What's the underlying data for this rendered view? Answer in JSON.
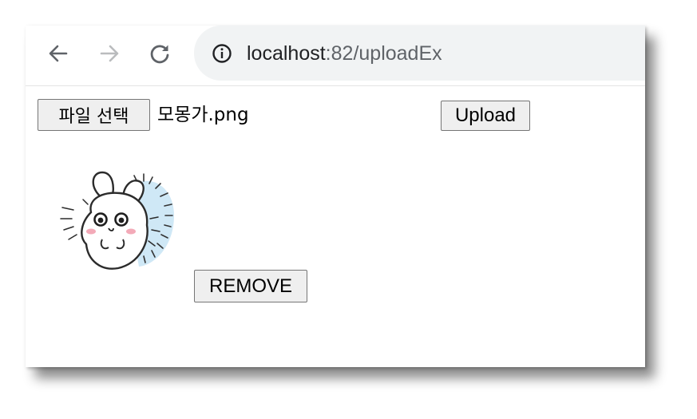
{
  "browser": {
    "back_icon": "arrow-left-icon",
    "forward_icon": "arrow-right-icon",
    "reload_icon": "reload-icon",
    "site_info_icon": "info-icon",
    "url_host": "localhost",
    "url_port": ":82",
    "url_path": "/uploadEx"
  },
  "upload_form": {
    "file_button_label": "파일 선택",
    "selected_file_name": "모몽가.png",
    "upload_button_label": "Upload"
  },
  "preview": {
    "thumbnail_subject": "rabbit-cartoon",
    "remove_button_label": "REMOVE"
  },
  "colors": {
    "toolbar_icon": "#5f6368",
    "toolbar_icon_disabled": "#babcbe",
    "omnibox_bg": "#f1f3f4",
    "button_bg": "#efefef",
    "button_border": "#767676",
    "thumb_accent": "#cfe8f6"
  }
}
